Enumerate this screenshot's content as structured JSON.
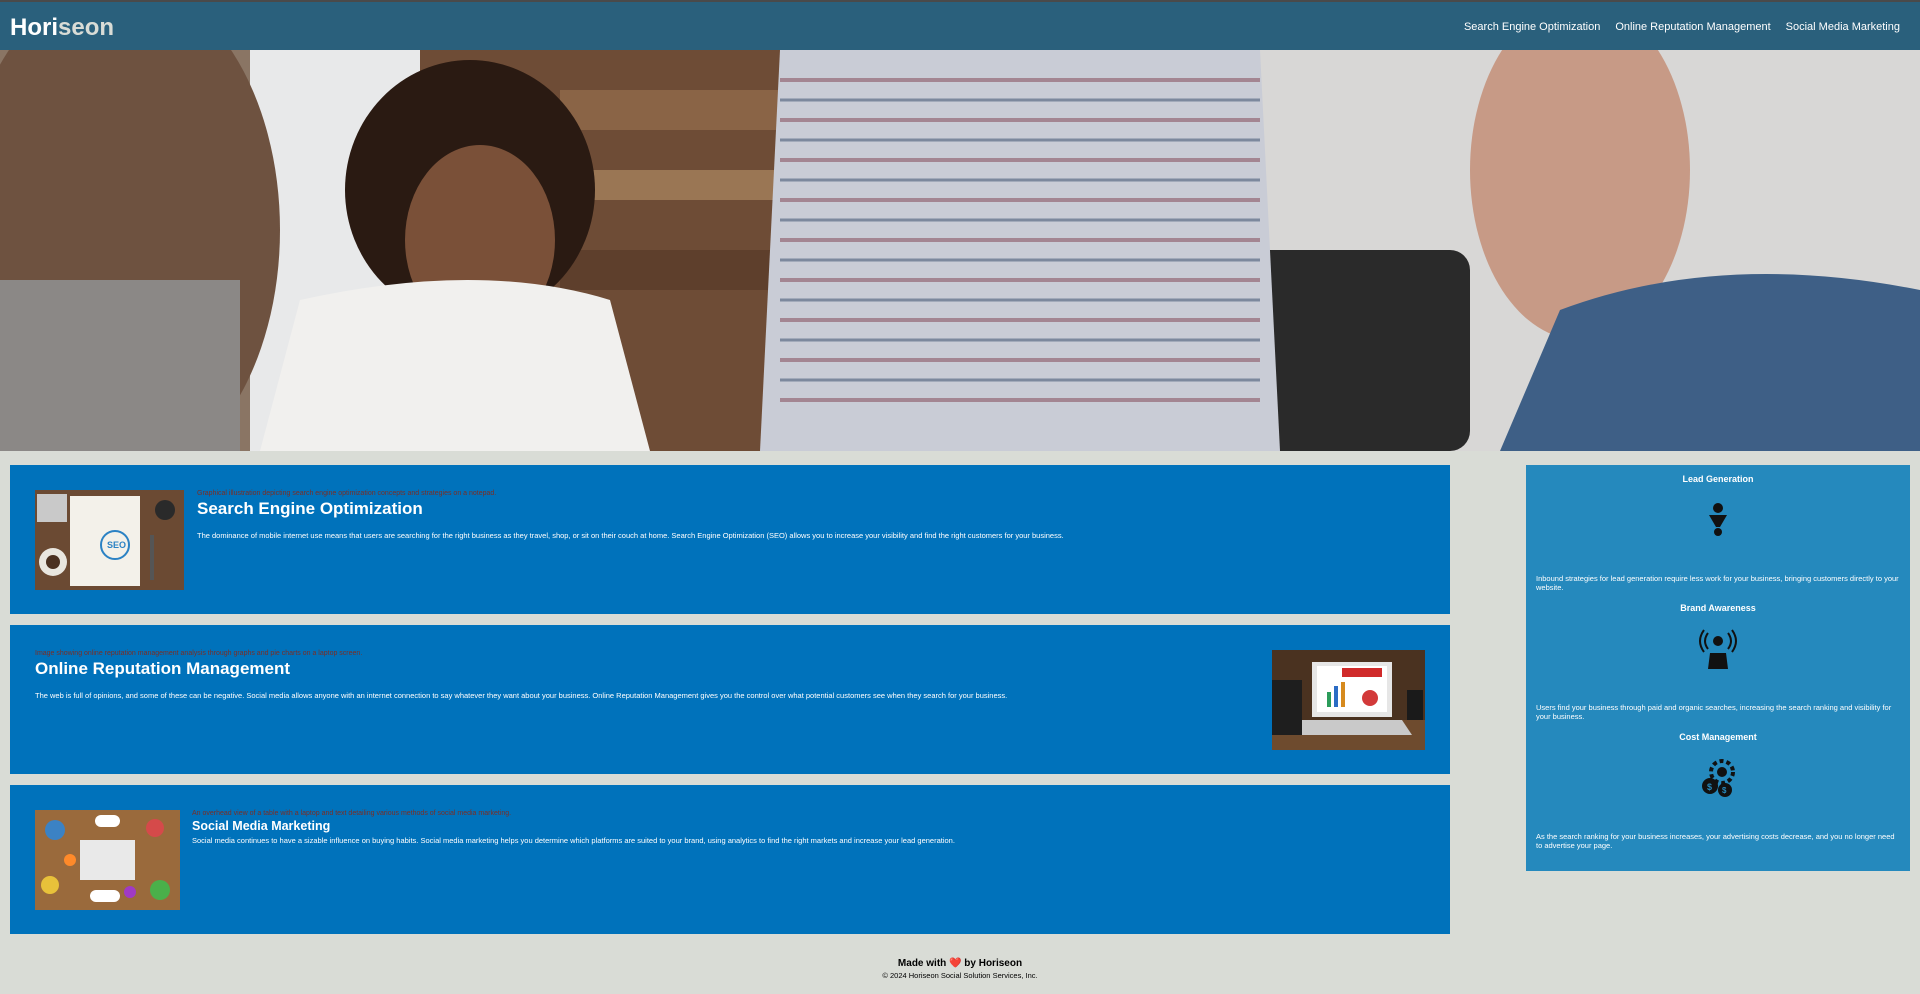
{
  "header": {
    "logo_main": "Hori",
    "logo_accent": "seon",
    "nav": [
      {
        "label": "Search Engine Optimization"
      },
      {
        "label": "Online Reputation Management"
      },
      {
        "label": "Social Media Marketing"
      }
    ]
  },
  "cards": [
    {
      "alt": "Graphical illustration depicting search engine optimization concepts and strategies on a notepad.",
      "title": "Search Engine Optimization",
      "body": "The dominance of mobile internet use means that users are searching for the right business as they travel, shop, or sit on their couch at home. Search Engine Optimization (SEO) allows you to increase your visibility and find the right customers for your business."
    },
    {
      "alt": "Image showing online reputation management analysis through graphs and pie charts on a laptop screen.",
      "title": "Online Reputation Management",
      "body": "The web is full of opinions, and some of these can be negative. Social media allows anyone with an internet connection to say whatever they want about your business. Online Reputation Management gives you the control over what potential customers see when they search for your business."
    },
    {
      "alt": "An overhead view of a table with a laptop and text detailing various methods of social media marketing.",
      "title": "Social Media Marketing",
      "body": "Social media continues to have a sizable influence on buying habits. Social media marketing helps you determine which platforms are suited to your brand, using analytics to find the right markets and increase your lead generation."
    }
  ],
  "sidebar": [
    {
      "title": "Lead Generation",
      "icon": "lead-generation-icon",
      "body": "Inbound strategies for lead generation require less work for your business, bringing customers directly to your website."
    },
    {
      "title": "Brand Awareness",
      "icon": "brand-awareness-icon",
      "body": "Users find your business through paid and organic searches, increasing the search ranking and visibility for your business."
    },
    {
      "title": "Cost Management",
      "icon": "cost-management-icon",
      "body": "As the search ranking for your business increases, your advertising costs decrease, and you no longer need to advertise your page."
    }
  ],
  "footer": {
    "made_prefix": "Made with",
    "heart": "❤️",
    "made_suffix": "by Horiseon",
    "copyright": "© 2024 Horiseon Social Solution Services, Inc."
  },
  "colors": {
    "header": "#2a607c",
    "card": "#0072bb",
    "sidebar": "#2589bd",
    "page": "#d9dcd6"
  }
}
